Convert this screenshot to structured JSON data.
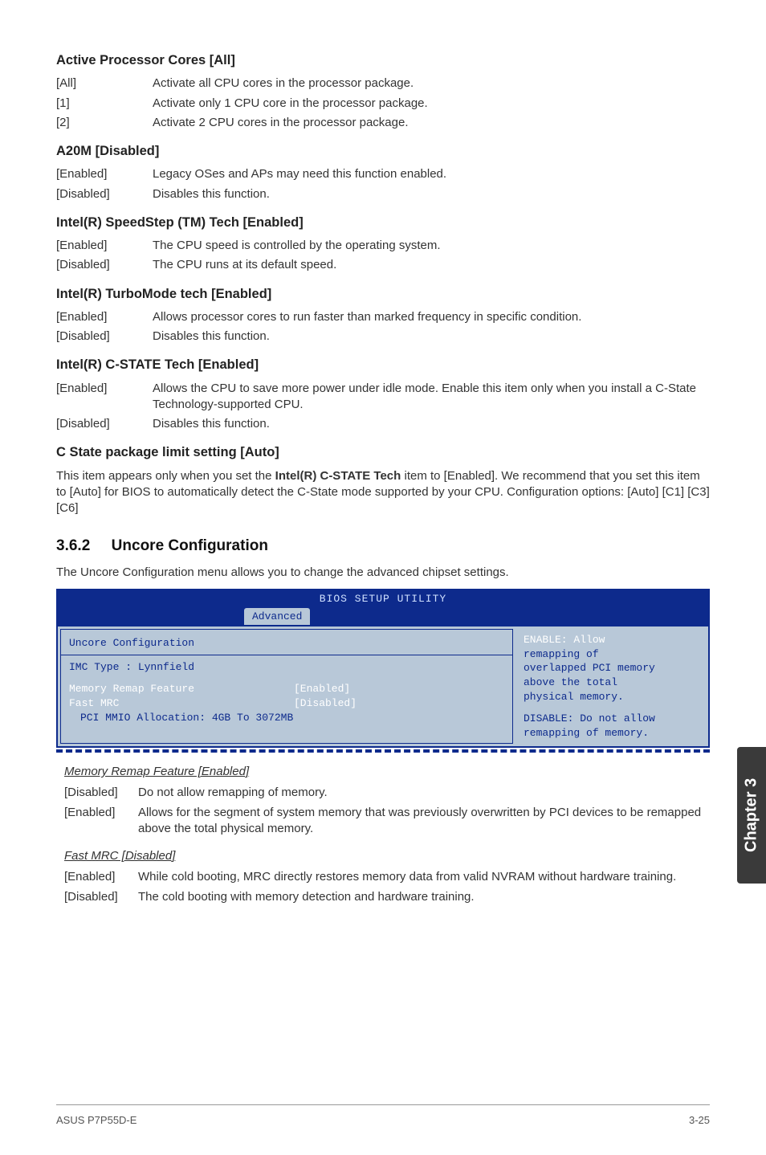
{
  "sections": {
    "apc": {
      "title": "Active Processor Cores [All]",
      "rows": [
        {
          "k": "[All]",
          "v": "Activate all CPU cores in the processor package."
        },
        {
          "k": "[1]",
          "v": "Activate only 1 CPU core in the processor package."
        },
        {
          "k": "[2]",
          "v": "Activate 2 CPU cores in the processor package."
        }
      ]
    },
    "a20m": {
      "title": "A20M [Disabled]",
      "rows": [
        {
          "k": "[Enabled]",
          "v": "Legacy OSes and APs may need this function enabled."
        },
        {
          "k": "[Disabled]",
          "v": "Disables this function."
        }
      ]
    },
    "speedstep": {
      "title": "Intel(R) SpeedStep (TM) Tech [Enabled]",
      "rows": [
        {
          "k": "[Enabled]",
          "v": "The CPU speed is controlled by the operating system."
        },
        {
          "k": "[Disabled]",
          "v": "The CPU runs at its default speed."
        }
      ]
    },
    "turbo": {
      "title": "Intel(R) TurboMode tech [Enabled]",
      "rows": [
        {
          "k": "[Enabled]",
          "v": "Allows processor cores to run faster than marked frequency in specific condition."
        },
        {
          "k": "[Disabled]",
          "v": "Disables this function."
        }
      ]
    },
    "cstate": {
      "title": "Intel(R) C-STATE Tech [Enabled]",
      "rows": [
        {
          "k": "[Enabled]",
          "v": "Allows the CPU to save more power under idle mode. Enable this item only when you install a C-State Technology-supported CPU."
        },
        {
          "k": "[Disabled]",
          "v": "Disables this function."
        }
      ]
    },
    "cstate_limit": {
      "title": "C State package limit setting [Auto]",
      "para_pre": "This item appears only when you set the ",
      "para_bold": "Intel(R) C-STATE Tech",
      "para_post": " item to [Enabled]. We recommend that you set this item to [Auto] for BIOS to automatically detect the C-State mode supported by your CPU. Configuration options: [Auto] [C1] [C3] [C6]"
    }
  },
  "subsection": {
    "number": "3.6.2",
    "title": "Uncore Configuration",
    "intro": "The Uncore Configuration menu allows you to change the advanced chipset settings."
  },
  "bios": {
    "window_title": "BIOS SETUP UTILITY",
    "tab": "Advanced",
    "left": {
      "heading": "Uncore Configuration",
      "imc": "IMC Type : Lynnfield",
      "rows": [
        {
          "label": "Memory Remap Feature",
          "value": "[Enabled]"
        },
        {
          "label": "Fast MRC",
          "value": "[Disabled]"
        }
      ],
      "pci": "PCI MMIO Allocation: 4GB To 3072MB"
    },
    "right": {
      "l1": "ENABLE: Allow",
      "l2": "remapping of",
      "l3": "overlapped PCI memory",
      "l4": "above the total",
      "l5": "physical memory.",
      "l6": "DISABLE: Do not allow",
      "l7": "remapping of memory."
    }
  },
  "features": {
    "mem_remap": {
      "title": "Memory Remap Feature [Enabled]",
      "rows": [
        {
          "k": "[Disabled]",
          "v": "Do not allow remapping of memory."
        },
        {
          "k": "[Enabled]",
          "v": "Allows for the segment of system memory that was previously overwritten by PCI devices to be remapped above the total physical memory."
        }
      ]
    },
    "fast_mrc": {
      "title": "Fast MRC [Disabled]",
      "rows": [
        {
          "k": "[Enabled]",
          "v": "While cold booting, MRC directly restores memory data from valid NVRAM without hardware training."
        },
        {
          "k": "[Disabled]",
          "v": "The cold booting with memory detection and hardware training."
        }
      ]
    }
  },
  "side_tab": "Chapter 3",
  "footer": {
    "left": "ASUS P7P55D-E",
    "right": "3-25"
  }
}
